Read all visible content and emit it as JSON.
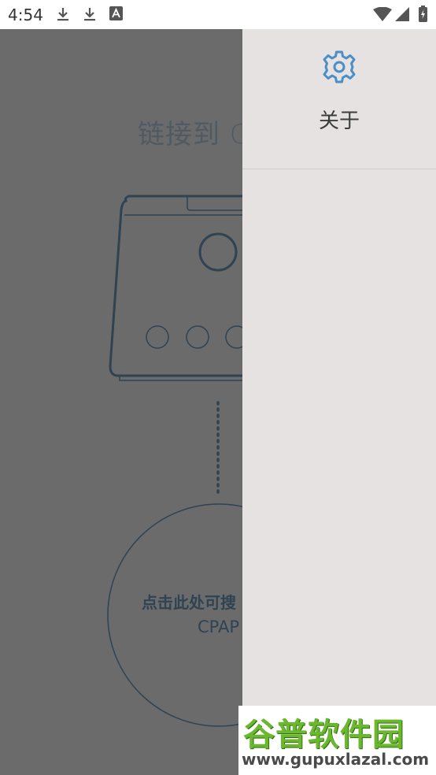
{
  "status_bar": {
    "time": "4:54",
    "icons": [
      "download-icon",
      "download-icon",
      "font-a-icon",
      "wifi-icon",
      "signal-icon",
      "battery-charging-icon"
    ]
  },
  "main": {
    "title": "链接到 C",
    "search_label": "点击此处可搜",
    "search_sub": "CPAP"
  },
  "drawer": {
    "items": [
      {
        "label": "关于",
        "icon": "gear-icon"
      }
    ]
  },
  "watermark": {
    "brand": "谷普软件园",
    "url": "www.gupuxlazal.com"
  },
  "colors": {
    "accent": "#4a8fc7",
    "drawer_bg": "#e6e2e1",
    "scrim": "#6b6b6b",
    "device_stroke": "#2f4352"
  }
}
